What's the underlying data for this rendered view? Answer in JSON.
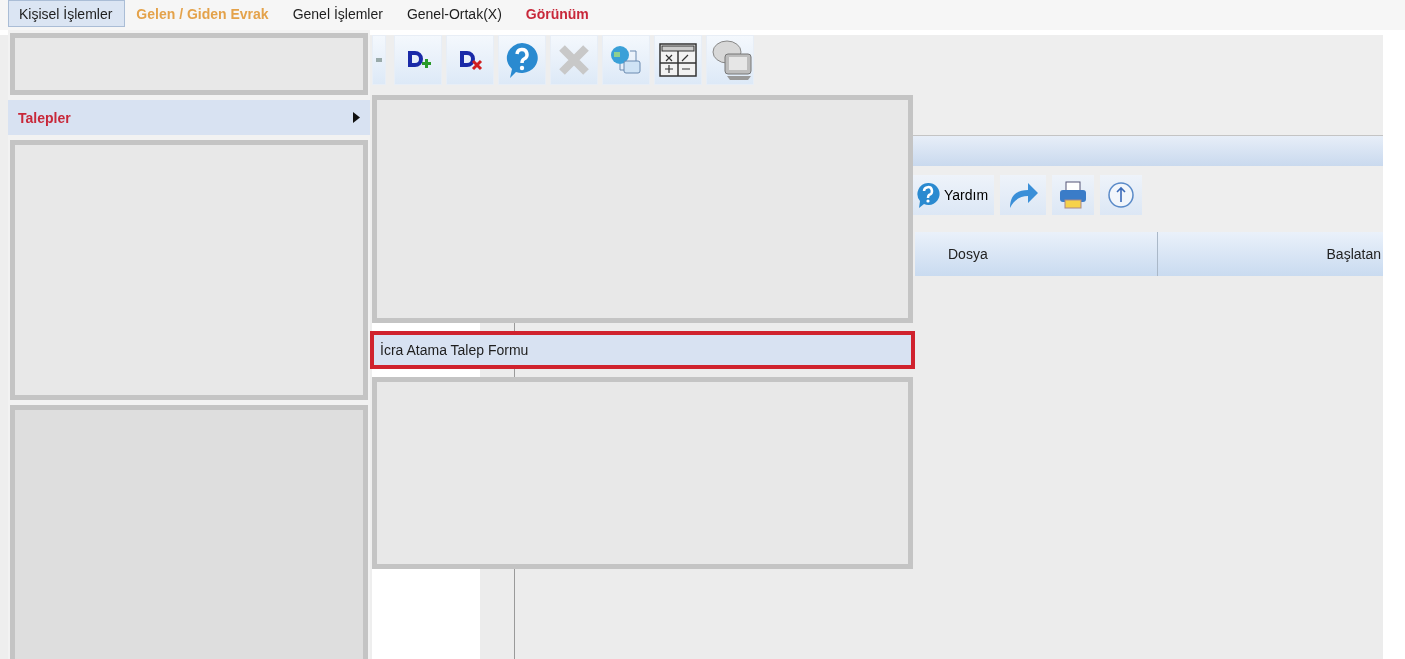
{
  "menu_bar": [
    {
      "label": "Kişisel İşlemler",
      "selected": true,
      "bold": false,
      "color": "#1e1e1e"
    },
    {
      "label": "Gelen / Giden Evrak",
      "selected": false,
      "bold": true,
      "color": "#e4a24a"
    },
    {
      "label": "Genel İşlemler",
      "selected": false,
      "bold": false,
      "color": "#1e1e1e"
    },
    {
      "label": "Genel-Ortak(X)",
      "selected": false,
      "bold": false,
      "color": "#1e1e1e"
    },
    {
      "label": "Görünüm",
      "selected": false,
      "bold": true,
      "color": "#c8283a"
    }
  ],
  "help_button": {
    "label": "Yardım"
  },
  "table": {
    "columns": [
      "Dosya",
      "Başlatan"
    ]
  },
  "menu": {
    "items": [
      {
        "kind": "blank"
      },
      {
        "kind": "item",
        "label": "Talepler",
        "selected": true,
        "bold": true,
        "has_submenu": true,
        "color": "#c8283a"
      },
      {
        "kind": "blank"
      },
      {
        "kind": "blank"
      }
    ]
  },
  "submenu": {
    "items": [
      {
        "kind": "blank"
      },
      {
        "kind": "item",
        "label": "İcra Atama Talep Formu",
        "selected": true,
        "highlighted": true,
        "color": "#1e1e1e"
      },
      {
        "kind": "blank"
      }
    ]
  }
}
